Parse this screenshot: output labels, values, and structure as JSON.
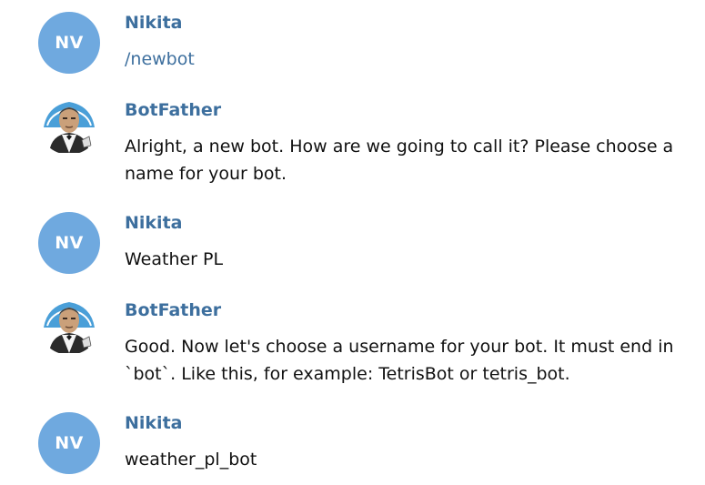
{
  "messages": [
    {
      "sender": "Nikita",
      "avatar_initials": "NV",
      "text": "/newbot"
    },
    {
      "sender": "BotFather",
      "avatar_icon": "botfather-avatar-icon",
      "text": "Alright, a new bot. How are we going to call it? Please choose a name for your bot."
    },
    {
      "sender": "Nikita",
      "avatar_initials": "NV",
      "text": "Weather PL"
    },
    {
      "sender": "BotFather",
      "avatar_icon": "botfather-avatar-icon",
      "text": "Good. Now let's choose a username for your bot. It must end in `bot`. Like this, for example: TetrisBot or tetris_bot."
    },
    {
      "sender": "Nikita",
      "avatar_initials": "NV",
      "text": "weather_pl_bot"
    }
  ],
  "colors": {
    "avatar_bg": "#6fa9df",
    "sender_name": "#3d6f9e",
    "command_link": "#3d6f9e",
    "message_text": "#111111"
  }
}
